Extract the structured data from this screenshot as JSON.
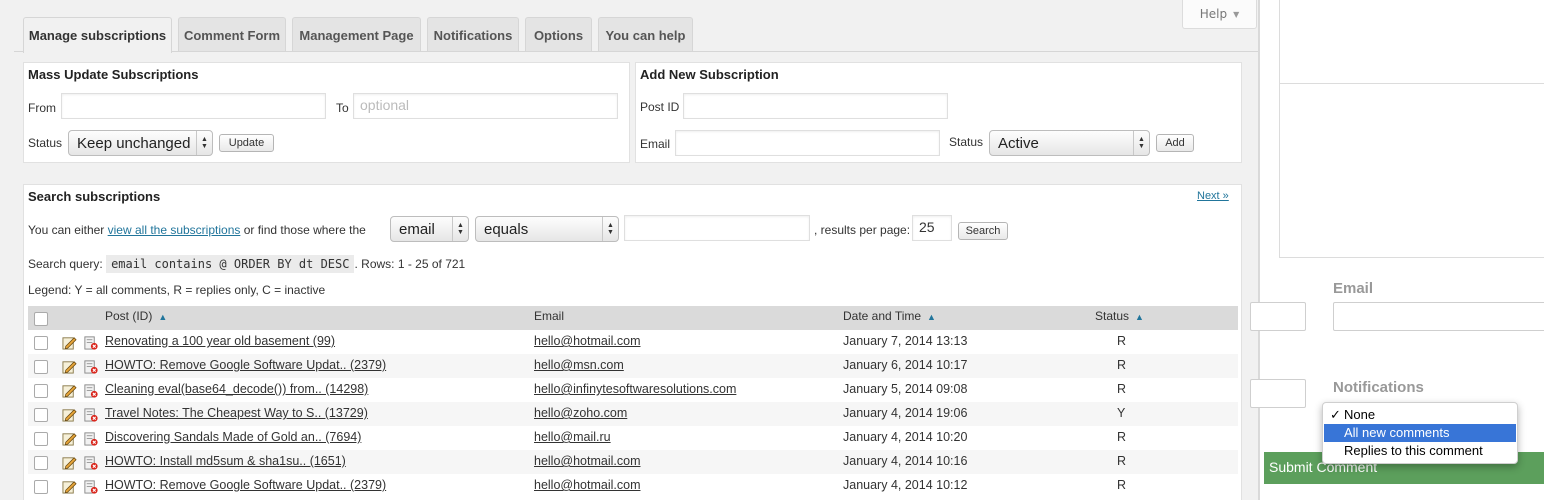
{
  "help": {
    "label": "Help"
  },
  "tabs": [
    {
      "label": "Manage subscriptions",
      "active": true
    },
    {
      "label": "Comment Form"
    },
    {
      "label": "Management Page"
    },
    {
      "label": "Notifications"
    },
    {
      "label": "Options"
    },
    {
      "label": "You can help"
    }
  ],
  "mass_update": {
    "title": "Mass Update Subscriptions",
    "from_label": "From",
    "from_value": "",
    "to_label": "To",
    "to_placeholder": "optional",
    "status_label": "Status",
    "status_value": "Keep unchanged",
    "button": "Update"
  },
  "add_new": {
    "title": "Add New Subscription",
    "post_id_label": "Post ID",
    "post_id_value": "",
    "email_label": "Email",
    "email_value": "",
    "status_label": "Status",
    "status_value": "Active",
    "button": "Add"
  },
  "search": {
    "title": "Search subscriptions",
    "next_link": "Next »",
    "intro_prefix": "You can either",
    "view_all_link": "view all the subscriptions",
    "intro_suffix": "or find those where the",
    "field_select": "email",
    "operator_select": "equals",
    "query_value": "",
    "results_label": ", results per page:",
    "per_page": "25",
    "button": "Search",
    "query_label": "Search query:",
    "query_code": "email contains @ ORDER BY dt DESC",
    "rows_text": ". Rows: 1 - 25 of 721",
    "legend": "Legend: Y = all comments, R = replies only, C = inactive"
  },
  "table": {
    "columns": {
      "post": "Post (ID)",
      "email": "Email",
      "date": "Date and Time",
      "status": "Status"
    },
    "rows": [
      {
        "post": "Renovating a 100 year old basement (99)",
        "email": "hello@hotmail.com",
        "date": "January 7, 2014 13:13",
        "status": "R"
      },
      {
        "post": "HOWTO: Remove Google Software Updat.. (2379)",
        "email": "hello@msn.com",
        "date": "January 6, 2014 10:17",
        "status": "R"
      },
      {
        "post": "Cleaning eval(base64_decode()) from.. (14298)",
        "email": "hello@infinytesoftwaresolutions.com",
        "date": "January 5, 2014 09:08",
        "status": "R"
      },
      {
        "post": "Travel Notes: The Cheapest Way to S.. (13729)",
        "email": "hello@zoho.com",
        "date": "January 4, 2014 19:06",
        "status": "Y"
      },
      {
        "post": "Discovering Sandals Made of Gold an.. (7694)",
        "email": "hello@mail.ru",
        "date": "January 4, 2014 10:20",
        "status": "R"
      },
      {
        "post": "HOWTO: Install md5sum & sha1su.. (1651)",
        "email": "hello@hotmail.com",
        "date": "January 4, 2014 10:16",
        "status": "R"
      },
      {
        "post": "HOWTO: Remove Google Software Updat.. (2379)",
        "email": "hello@hotmail.com",
        "date": "January 4, 2014 10:12",
        "status": "R"
      }
    ]
  },
  "comment_form": {
    "email_label": "Email",
    "notifications_label": "Notifications",
    "options": [
      {
        "label": "None",
        "checked": true
      },
      {
        "label": "All new comments",
        "highlighted": true
      },
      {
        "label": "Replies to this comment"
      }
    ],
    "check_mark": "✓",
    "submit_label": "Submit Comment"
  },
  "colors": {
    "link": "#21759b",
    "highlight": "#3875d7",
    "submit": "#5c9f5c"
  }
}
